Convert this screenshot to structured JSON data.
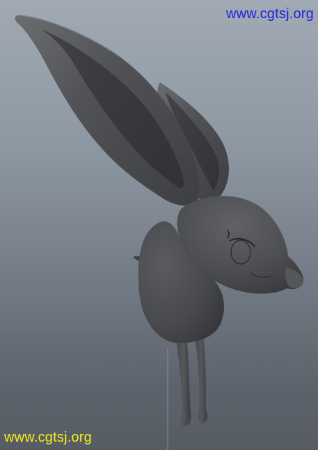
{
  "watermark": {
    "top_text": "www.cgtsj.org",
    "bottom_text": "www.cgtsj.org",
    "top_color": "#1f22e0",
    "bottom_color": "#f6ef1a"
  },
  "viewport": {
    "background_top": "#a1aab4",
    "background_bottom": "#575c64"
  },
  "model": {
    "subject": "rabbit-sculpt",
    "material_color": "#4b4c4f"
  }
}
